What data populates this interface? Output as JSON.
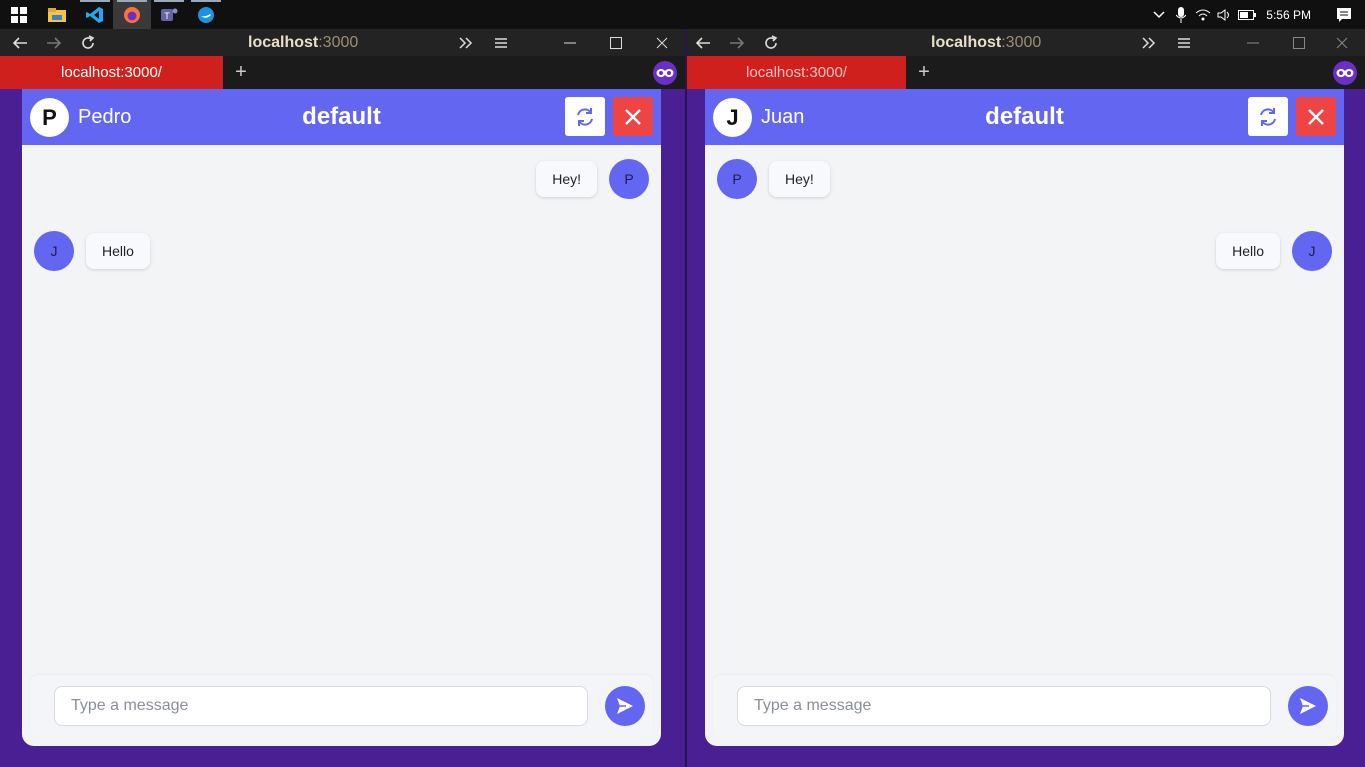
{
  "taskbar": {
    "apps": [
      {
        "name": "file-explorer-icon",
        "color": "#f6c343"
      },
      {
        "name": "vscode-icon",
        "color": "#23a9f2"
      },
      {
        "name": "firefox-icon",
        "color": "#ff7139"
      },
      {
        "name": "teams-icon",
        "color": "#6264a7"
      },
      {
        "name": "docker-icon",
        "color": "#1d91e6"
      }
    ],
    "clock": "5:56 PM"
  },
  "colors": {
    "accent": "#6366f1",
    "danger": "#ef4444",
    "tab": "#d0201e",
    "background": "#4a1f94"
  },
  "windows": [
    {
      "url_host": "localhost",
      "url_port": ":3000",
      "tab_label": "localhost:3000/",
      "new_tab": "+",
      "user": {
        "initial": "P",
        "name": "Pedro"
      },
      "room": "default",
      "messages": [
        {
          "side": "right",
          "avatar": "P",
          "text": "Hey!"
        },
        {
          "side": "left",
          "avatar": "J",
          "text": "Hello"
        }
      ],
      "input_placeholder": "Type a message"
    },
    {
      "url_host": "localhost",
      "url_port": ":3000",
      "tab_label": "localhost:3000/",
      "new_tab": "+",
      "user": {
        "initial": "J",
        "name": "Juan"
      },
      "room": "default",
      "messages": [
        {
          "side": "left",
          "avatar": "P",
          "text": "Hey!"
        },
        {
          "side": "right",
          "avatar": "J",
          "text": "Hello"
        }
      ],
      "input_placeholder": "Type a message"
    }
  ]
}
